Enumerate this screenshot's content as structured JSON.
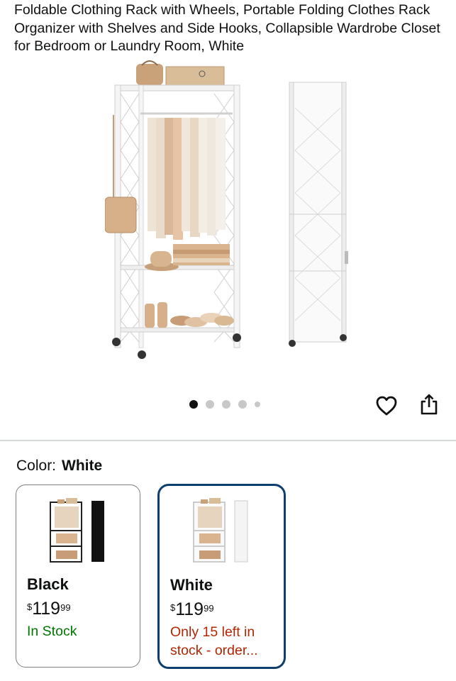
{
  "product": {
    "title": "Foldable Clothing Rack with Wheels, Portable Folding Clothes Rack Organizer with Shelves and Side Hooks, Collapsible Wardrobe Closet for Bedroom or Laundry Room,   White"
  },
  "gallery": {
    "image_count": 5,
    "active_index": 0,
    "icons": [
      "heart-icon",
      "share-icon"
    ]
  },
  "color": {
    "label": "Color:",
    "selected": "White"
  },
  "variants": [
    {
      "name": "Black",
      "currency": "$",
      "price_whole": "119",
      "price_cents": "99",
      "stock": "In Stock",
      "stock_color": "#007600",
      "selected": false
    },
    {
      "name": "White",
      "currency": "$",
      "price_whole": "119",
      "price_cents": "99",
      "stock": "Only 15 left in stock - order...",
      "stock_color": "#b12704",
      "selected": true
    }
  ],
  "colors": {
    "selected_border": "#0e3e6e",
    "divider": "#d5d9d9"
  }
}
